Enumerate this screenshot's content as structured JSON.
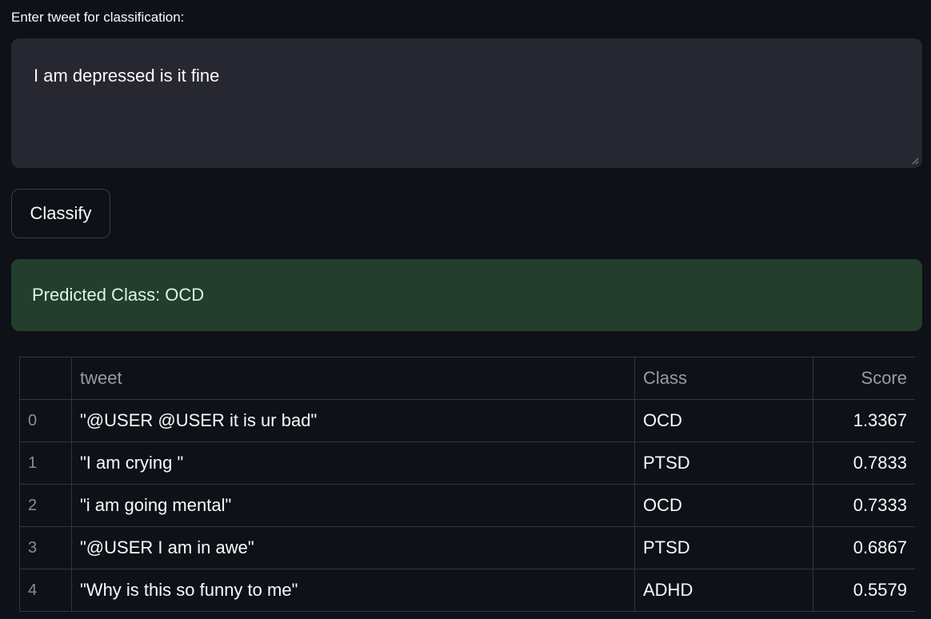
{
  "form": {
    "label": "Enter tweet for classification:",
    "tweet_value": "I am depressed is it fine",
    "button_label": "Classify"
  },
  "result": {
    "text": "Predicted Class: OCD"
  },
  "table": {
    "columns": [
      "",
      "tweet",
      "Class",
      "Score"
    ],
    "rows": [
      {
        "index": "0",
        "tweet": "\"@USER @USER it is ur bad\"",
        "class": "OCD",
        "score": "1.3367"
      },
      {
        "index": "1",
        "tweet": "\"I am crying \"",
        "class": "PTSD",
        "score": "0.7833"
      },
      {
        "index": "2",
        "tweet": "\"i am going mental\"",
        "class": "OCD",
        "score": "0.7333"
      },
      {
        "index": "3",
        "tweet": "\"@USER I am in awe\"",
        "class": "PTSD",
        "score": "0.6867"
      },
      {
        "index": "4",
        "tweet": "\"Why is this so funny to me\"",
        "class": "ADHD",
        "score": "0.5579"
      }
    ]
  },
  "colors": {
    "background": "#0e1117",
    "input_bg": "#262730",
    "success_bg": "#233e2d",
    "success_text": "#dff5e3"
  },
  "icons": {
    "resize": "resize-grip-icon"
  }
}
